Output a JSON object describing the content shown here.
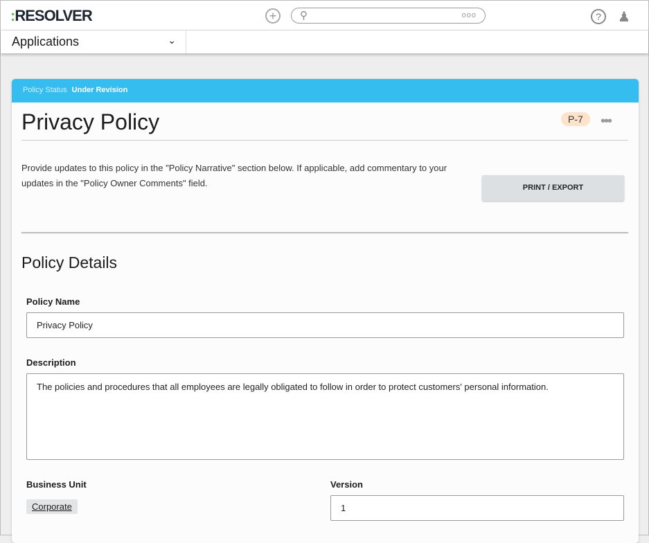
{
  "header": {
    "logo": "RESOLVER",
    "search_more": "ooo"
  },
  "nav": {
    "applications": "Applications"
  },
  "record": {
    "status_label": "Policy Status",
    "status_value": "Under Revision",
    "title": "Privacy Policy",
    "id_badge": "P-7",
    "more": "•••",
    "intro": "Provide updates to this policy in the \"Policy Narrative\" section below. If applicable, add commentary to your updates in the \"Policy Owner Comments\" field.",
    "print_button": "PRINT / EXPORT",
    "section_title": "Policy Details",
    "fields": {
      "policy_name_label": "Policy Name",
      "policy_name_value": "Privacy Policy",
      "description_label": "Description",
      "description_value": "The policies and procedures that all employees are legally obligated to follow in order to protect customers' personal information.",
      "business_unit_label": "Business Unit",
      "business_unit_value": "Corporate",
      "version_label": "Version",
      "version_value": "1"
    }
  }
}
